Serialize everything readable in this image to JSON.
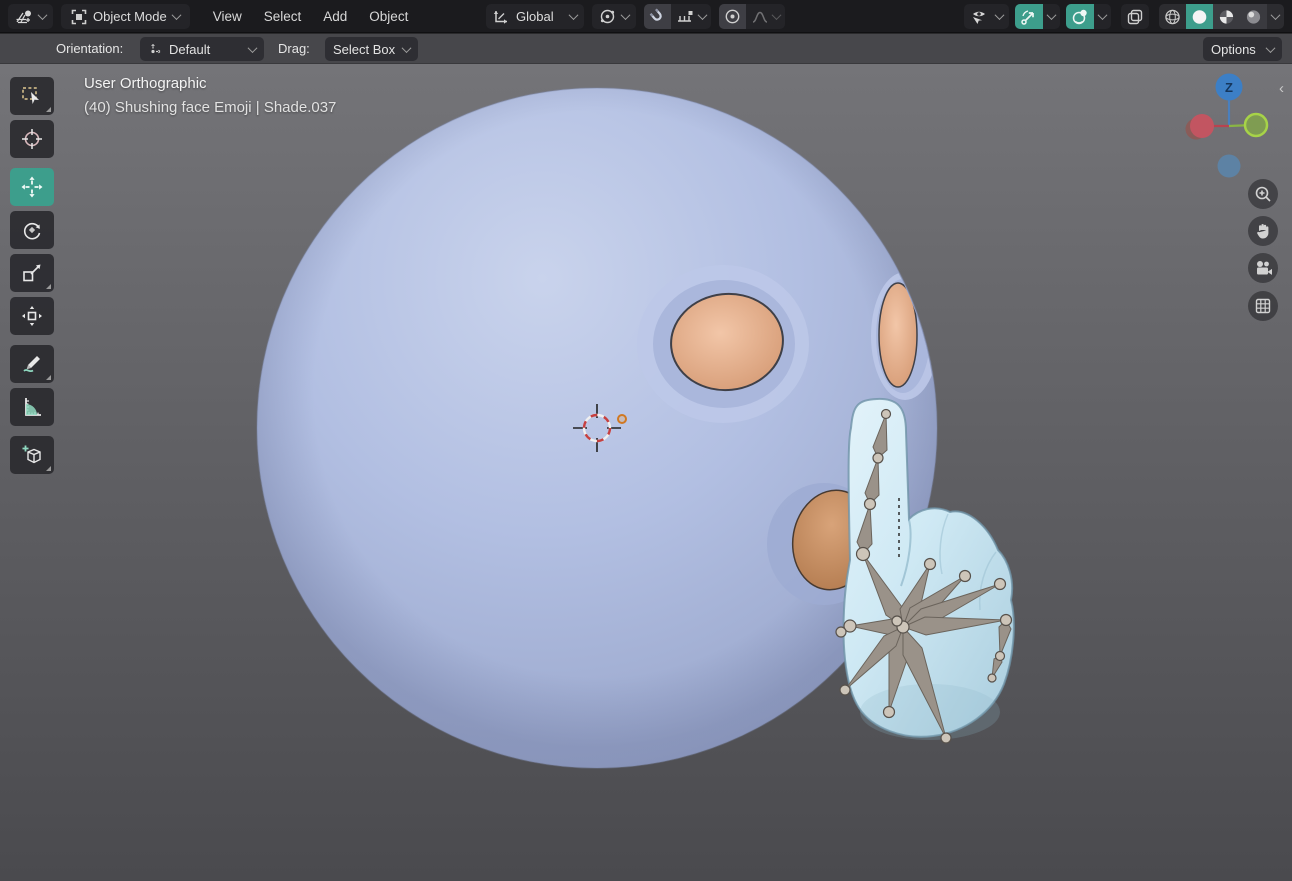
{
  "app": {
    "title": "Blender - 3D Viewport"
  },
  "header": {
    "editor_type": "3D Viewport",
    "mode": {
      "label": "Object Mode"
    },
    "menus": [
      {
        "label": "View"
      },
      {
        "label": "Select"
      },
      {
        "label": "Add"
      },
      {
        "label": "Object"
      }
    ],
    "transform_orientation": {
      "label": "Global"
    },
    "controls": {
      "pivot": "transform-pivot-point",
      "snap": "snapping-magnet",
      "snap_with": "snap-increments",
      "proportional": "proportional-editing",
      "falloff": "proportional-falloff",
      "visibility": "object-type-visibility",
      "gizmos": "show-gizmos",
      "overlays": "show-overlays",
      "xray": "toggle-xray",
      "shading_modes": [
        "Wireframe",
        "Solid",
        "Material Preview",
        "Rendered"
      ],
      "shading_active": "Solid"
    }
  },
  "tool_settings": {
    "orientation_label": "Orientation:",
    "orientation_value": "Default",
    "drag_label": "Drag:",
    "drag_value": "Select Box",
    "options_label": "Options"
  },
  "toolbar": {
    "tools": [
      "Select Box",
      "Cursor",
      "Move",
      "Rotate",
      "Scale",
      "Transform",
      "Annotate",
      "Measure",
      "Add Cube"
    ],
    "active_tool": "Move"
  },
  "viewport": {
    "overlay_text": {
      "line1": "User Orthographic",
      "line2": "(40) Shushing face Emoji | Shade.037"
    },
    "gizmo": {
      "z_label": "Z",
      "x_color": "#c25561",
      "x_ghost_color": "#a04b41",
      "y_color": "#7f9c52",
      "y_ring_color": "#a7d348",
      "z_color": "#3c7fc6",
      "neg_z_color": "#5d82a4"
    },
    "nav_buttons": [
      "zoom",
      "pan",
      "camera-view",
      "grid-view"
    ]
  },
  "scene": {
    "object_name": "Shushing face Emoji",
    "colors": {
      "background_top": "#747478",
      "background_bottom": "#4a4a4e",
      "head_light": "#c9d3ec",
      "head": "#b2bfe2",
      "head_dark": "#97a4c9",
      "head_rim": "#5a648c",
      "socket": "#bcc8e8",
      "socket_inner": "#aab7dc",
      "skin": "#f2c6a8",
      "skin_dark": "#d59a74",
      "mouth": "#d8a379",
      "mouth_dark": "#b27a4e",
      "hand_light": "#e3f3fa",
      "hand": "#cfe9f4",
      "hand_dark": "#accfdf",
      "bone": "#9a9289",
      "joint": "#cdc5b9",
      "accent": "#3d9e8c",
      "cursor_red": "#c64040",
      "origin_orange": "#d07822"
    }
  }
}
